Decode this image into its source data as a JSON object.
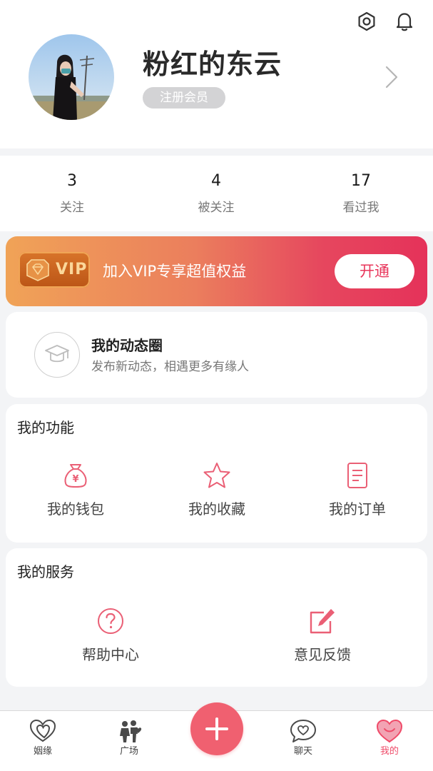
{
  "profile": {
    "username": "粉红的东云",
    "member_badge": "注册会员"
  },
  "stats": [
    {
      "count": "3",
      "label": "关注"
    },
    {
      "count": "4",
      "label": "被关注"
    },
    {
      "count": "17",
      "label": "看过我"
    }
  ],
  "vip": {
    "badge": "VIP",
    "promo": "加入VIP专享超值权益",
    "button": "开通"
  },
  "moments": {
    "title": "我的动态圈",
    "subtitle": "发布新动态，相遇更多有缘人"
  },
  "functions": {
    "title": "我的功能",
    "items": [
      {
        "label": "我的钱包",
        "icon": "wallet-icon"
      },
      {
        "label": "我的收藏",
        "icon": "star-icon"
      },
      {
        "label": "我的订单",
        "icon": "order-icon"
      }
    ]
  },
  "services": {
    "title": "我的服务",
    "items": [
      {
        "label": "帮助中心",
        "icon": "help-icon"
      },
      {
        "label": "意见反馈",
        "icon": "feedback-icon"
      }
    ]
  },
  "tabbar": {
    "items": [
      {
        "label": "姻缘",
        "icon": "hearts-icon"
      },
      {
        "label": "广场",
        "icon": "couple-icon"
      },
      {
        "label": "聊天",
        "icon": "chat-heart-icon"
      },
      {
        "label": "我的",
        "icon": "heart-face-icon"
      }
    ],
    "active_index": 3
  },
  "colors": {
    "accent": "#ef4b69",
    "icon_pink": "#ea5f75",
    "fab": "#f06070"
  }
}
